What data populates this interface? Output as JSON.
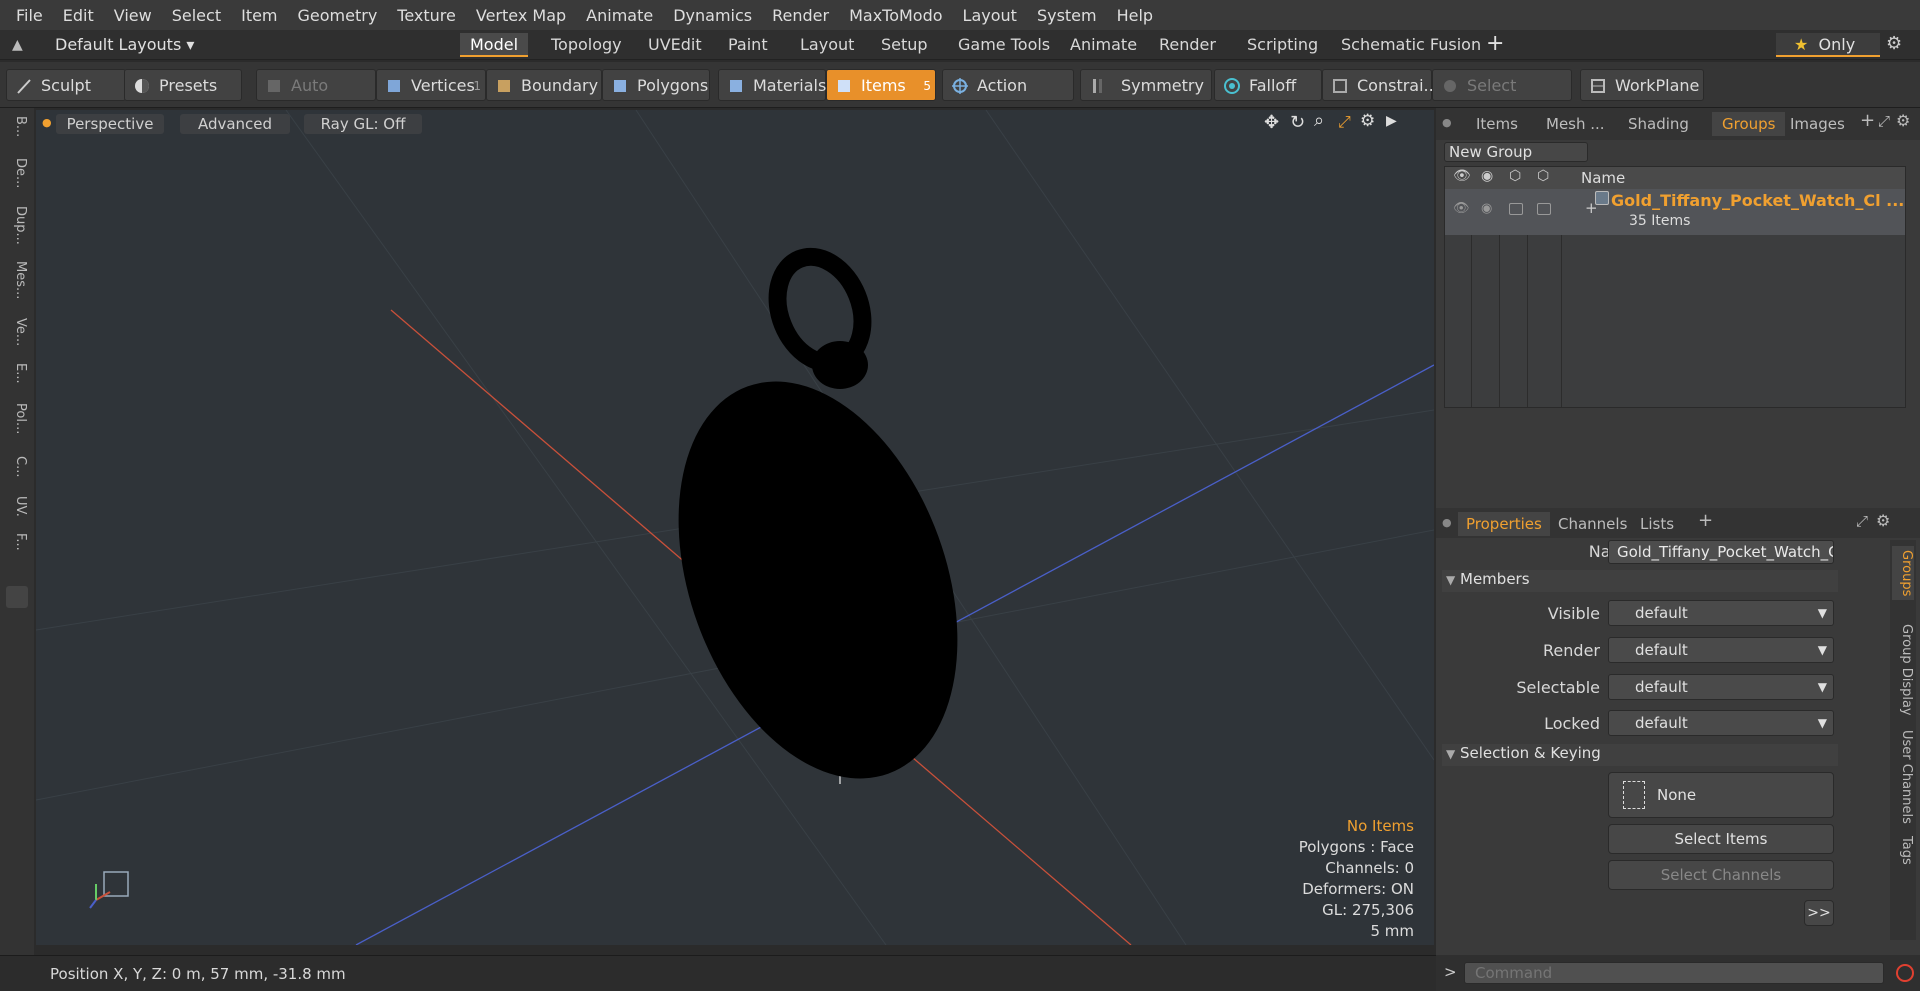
{
  "menu": [
    "File",
    "Edit",
    "View",
    "Select",
    "Item",
    "Geometry",
    "Texture",
    "Vertex Map",
    "Animate",
    "Dynamics",
    "Render",
    "MaxToModo",
    "Layout",
    "System",
    "Help"
  ],
  "layout_bar": {
    "layouts_label": "Default Layouts",
    "tabs": [
      "Model",
      "Topology",
      "UVEdit",
      "Paint",
      "Layout",
      "Setup",
      "Game Tools",
      "Animate",
      "Render",
      "Scripting",
      "Schematic Fusion"
    ],
    "active_tab": "Model",
    "only_label": "Only"
  },
  "toolbar": {
    "sculpt": "Sculpt",
    "presets": "Presets",
    "auto_select": "Auto Select",
    "vertices": "Vertices",
    "vertices_count": "1",
    "boundary": "Boundary",
    "polygons": "Polygons",
    "materials": "Materials",
    "items": "Items",
    "items_count": "5",
    "action_center": "Action Center",
    "symmetry": "Symmetry",
    "falloff": "Falloff",
    "constraints": "Constrai...",
    "select_through": "Select Through",
    "workplane": "WorkPlane"
  },
  "left_tabs": [
    "B...",
    "De...",
    "Dup...",
    "Mes...",
    "Ve...",
    "E...",
    "Pol...",
    "C...",
    "UV.",
    "F..."
  ],
  "viewport": {
    "perspective": "Perspective",
    "advanced": "Advanced",
    "raygl": "Ray GL: Off",
    "stats": {
      "no_items": "No Items",
      "polygons": "Polygons : Face",
      "channels": "Channels: 0",
      "deformers": "Deformers: ON",
      "gl": "GL: 275,306",
      "scale": "5 mm"
    }
  },
  "status": {
    "position": "Position X, Y, Z:   0 m, 57 mm, -31.8 mm"
  },
  "groups_panel": {
    "tabs": [
      "Items",
      "Mesh ...",
      "Shading",
      "Groups",
      "Images"
    ],
    "active_tab": "Groups",
    "new_group": "New Group",
    "col_name": "Name",
    "group_name": "Gold_Tiffany_Pocket_Watch_Cl ...",
    "group_count": "35 Items"
  },
  "properties_panel": {
    "tabs": [
      "Properties",
      "Channels",
      "Lists"
    ],
    "active_tab": "Properties",
    "name_label": "Name",
    "name_value": "Gold_Tiffany_Pocket_Watch_Closed (",
    "members_header": "Members",
    "fields": [
      {
        "label": "Visible",
        "value": "default"
      },
      {
        "label": "Render",
        "value": "default"
      },
      {
        "label": "Selectable",
        "value": "default"
      },
      {
        "label": "Locked",
        "value": "default"
      }
    ],
    "selection_header": "Selection & Keying",
    "none_label": "None",
    "select_items": "Select Items",
    "select_channels": "Select Channels",
    "more": ">>",
    "side_tabs": [
      "Groups",
      "Group Display",
      "User Channels",
      "Tags"
    ]
  },
  "command": {
    "prompt": ">",
    "placeholder": "Command"
  },
  "colors": {
    "accent": "#f0a030",
    "viewport_bg": "#2f3439",
    "axis_x": "#c8503a",
    "axis_z": "#4a5fc8"
  }
}
